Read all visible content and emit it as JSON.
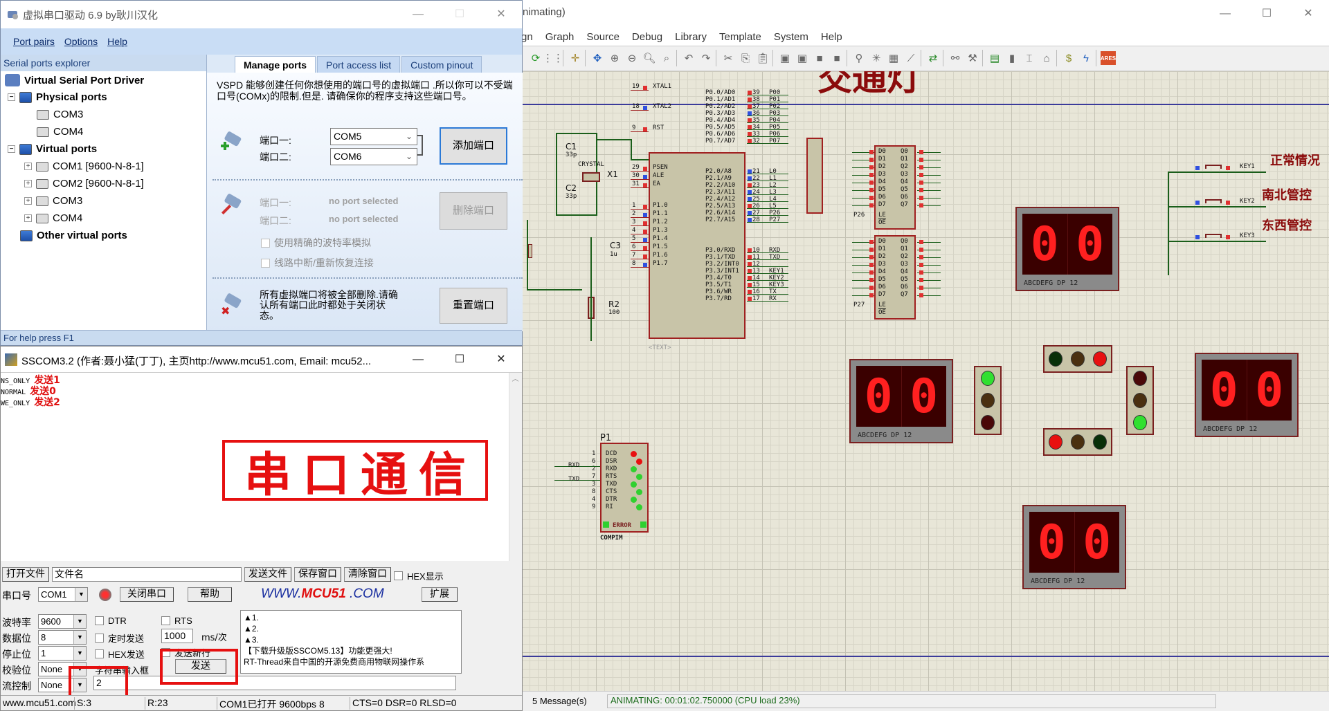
{
  "proteus": {
    "title": "nimating)",
    "window_controls": {
      "minimize": "—",
      "maximize": "☐",
      "close": "✕"
    },
    "menu": [
      "gn",
      "Graph",
      "Source",
      "Debug",
      "Library",
      "Template",
      "System",
      "Help"
    ],
    "toolbar_icons": [
      "refresh-icon",
      "grid-icon",
      "origin-icon",
      "pan-icon",
      "zoom-in-icon",
      "zoom-out-icon",
      "zoom-all-icon",
      "zoom-area-icon",
      "undo-icon",
      "redo-icon",
      "cut-icon",
      "copy-icon",
      "paste-icon",
      "block-copy-icon",
      "block-move-icon",
      "block-rotate-icon",
      "block-delete-icon",
      "pick-device-icon",
      "make-device-icon",
      "packaging-icon",
      "decompose-icon",
      "wire-autorouter-icon",
      "search-icon",
      "property-assign-icon",
      "new-sheet-icon",
      "remove-sheet-icon",
      "exit-sheet-icon",
      "goto-child-icon",
      "bill-of-materials-icon",
      "electrical-rule-check-icon",
      "ares-icon"
    ],
    "ares_label": "ARES",
    "schematic": {
      "title_fragment": "交通灯",
      "mcu": {
        "left_pins": [
          {
            "num": "19",
            "name": "XTAL1"
          },
          {
            "num": "18",
            "name": "XTAL2"
          },
          {
            "num": "9",
            "name": "RST"
          },
          {
            "num": "29",
            "name": "PSEN"
          },
          {
            "num": "30",
            "name": "ALE"
          },
          {
            "num": "31",
            "name": "EA"
          },
          {
            "num": "1",
            "name": "P1.0"
          },
          {
            "num": "2",
            "name": "P1.1"
          },
          {
            "num": "3",
            "name": "P1.2"
          },
          {
            "num": "4",
            "name": "P1.3"
          },
          {
            "num": "5",
            "name": "P1.4"
          },
          {
            "num": "6",
            "name": "P1.5"
          },
          {
            "num": "7",
            "name": "P1.6"
          },
          {
            "num": "8",
            "name": "P1.7"
          }
        ],
        "right_pins": [
          {
            "num": "39",
            "name": "P0.0/AD0",
            "net": "P00"
          },
          {
            "num": "38",
            "name": "P0.1/AD1",
            "net": "P01"
          },
          {
            "num": "37",
            "name": "P0.2/AD2",
            "net": "P02"
          },
          {
            "num": "36",
            "name": "P0.3/AD3",
            "net": "P03"
          },
          {
            "num": "35",
            "name": "P0.4/AD4",
            "net": "P04"
          },
          {
            "num": "34",
            "name": "P0.5/AD5",
            "net": "P05"
          },
          {
            "num": "33",
            "name": "P0.6/AD6",
            "net": "P06"
          },
          {
            "num": "32",
            "name": "P0.7/AD7",
            "net": "P07"
          },
          {
            "num": "21",
            "name": "P2.0/A8",
            "net": "L0"
          },
          {
            "num": "22",
            "name": "P2.1/A9",
            "net": "L1"
          },
          {
            "num": "23",
            "name": "P2.2/A10",
            "net": "L2"
          },
          {
            "num": "24",
            "name": "P2.3/A11",
            "net": "L3"
          },
          {
            "num": "25",
            "name": "P2.4/A12",
            "net": "L4"
          },
          {
            "num": "26",
            "name": "P2.5/A13",
            "net": "L5"
          },
          {
            "num": "27",
            "name": "P2.6/A14",
            "net": "P26"
          },
          {
            "num": "28",
            "name": "P2.7/A15",
            "net": "P27"
          },
          {
            "num": "10",
            "name": "P3.0/RXD",
            "net": "RXD"
          },
          {
            "num": "11",
            "name": "P3.1/TXD",
            "net": "TXD"
          },
          {
            "num": "12",
            "name": "P3.2/INT0",
            "net": ""
          },
          {
            "num": "13",
            "name": "P3.3/INT1",
            "net": "KEY1"
          },
          {
            "num": "14",
            "name": "P3.4/T0",
            "net": "KEY2"
          },
          {
            "num": "15",
            "name": "P3.5/T1",
            "net": "KEY3"
          },
          {
            "num": "16",
            "name": "P3.6/WR",
            "net": "TX"
          },
          {
            "num": "17",
            "name": "P3.7/RD",
            "net": "RX"
          }
        ],
        "text_tag": "<TEXT>"
      },
      "components": {
        "c1": {
          "ref": "C1",
          "value": "33p"
        },
        "c2": {
          "ref": "C2",
          "value": "33p"
        },
        "c3": {
          "ref": "C3",
          "value": "1u"
        },
        "r2": {
          "ref": "R2",
          "value": "100"
        },
        "x1": {
          "ref": "X1",
          "value": "CRYSTAL"
        },
        "p1": {
          "ref": "P1",
          "value": "COMPIM",
          "pins": [
            "DCD",
            "DSR",
            "RXD",
            "RTS",
            "TXD",
            "CTS",
            "DTR",
            "RI"
          ],
          "pin_nums": [
            "1",
            "6",
            "2",
            "7",
            "3",
            "8",
            "4",
            "9"
          ],
          "error_label": "ERROR",
          "nets": {
            "rxd": "RXD",
            "txd": "TXD"
          }
        }
      },
      "latch": {
        "inputs": [
          "D0",
          "D1",
          "D2",
          "D3",
          "D4",
          "D5",
          "D6",
          "D7"
        ],
        "outputs": [
          "Q0",
          "Q1",
          "Q2",
          "Q3",
          "Q4",
          "Q5",
          "Q6",
          "Q7"
        ],
        "le": "LE",
        "oe": "OE",
        "u1_le_net": "P26",
        "u2_le_net": "P27"
      },
      "keys": [
        {
          "net": "KEY1",
          "label": "正常情况"
        },
        {
          "net": "KEY2",
          "label": "南北管控"
        },
        {
          "net": "KEY3",
          "label": "东西管控"
        }
      ],
      "displays": [
        {
          "id": "north",
          "digits": [
            "0",
            "0"
          ],
          "caption": "ABCDEFG  DP     12"
        },
        {
          "id": "west",
          "digits": [
            "0",
            "0"
          ],
          "caption": "ABCDEFG  DP     12"
        },
        {
          "id": "east",
          "digits": [
            "0",
            "0"
          ],
          "caption": "ABCDEFG  DP     12"
        },
        {
          "id": "south",
          "digits": [
            "0",
            "0"
          ],
          "caption": "ABCDEFG  DP     12"
        }
      ],
      "traffic_lights": {
        "north": {
          "lamps": [
            "green-off",
            "yellow-off",
            "red-on"
          ],
          "pins": [
            "L0",
            "L1",
            "L2"
          ]
        },
        "south": {
          "lamps": [
            "red-on",
            "yellow-off",
            "green-off"
          ],
          "pins": [
            "L2",
            "L1",
            "L0"
          ]
        },
        "west": {
          "lamps": [
            "green-on",
            "yellow-off",
            "red-off"
          ],
          "pins": [
            "L5",
            "L4",
            "L3"
          ]
        },
        "east": {
          "lamps": [
            "red-off",
            "yellow-off",
            "green-on"
          ],
          "pins": [
            "L3",
            "L4",
            "L5"
          ]
        }
      },
      "lamp_colors": {
        "red_on": "#e81010",
        "red_off": "#4a0808",
        "yellow_off": "#4a3010",
        "green_on": "#30e030",
        "green_off": "#083008"
      }
    },
    "status": {
      "messages": "5 Message(s)",
      "animating": "ANIMATING: 00:01:02.750000 (CPU load 23%)"
    }
  },
  "vspd": {
    "title": "虚拟串口驱动 6.9 by耿川汉化",
    "menu": [
      "Port pairs",
      "Options",
      "Help"
    ],
    "explorer": {
      "header": "Serial ports explorer",
      "root": "Virtual Serial Port Driver",
      "physical": {
        "label": "Physical ports",
        "items": [
          "COM3",
          "COM4"
        ]
      },
      "virtual": {
        "label": "Virtual ports",
        "items": [
          "COM1 [9600-N-8-1]",
          "COM2 [9600-N-8-1]",
          "COM3",
          "COM4"
        ]
      },
      "other": "Other virtual ports"
    },
    "tabs": [
      "Manage ports",
      "Port access list",
      "Custom pinout"
    ],
    "description": "VSPD 能够创建任何你想使用的端口号的虚拟端口 .所以你可以不受端口号(COMx)的限制.但是. 请确保你的程序支持这些端口号。",
    "add": {
      "port1_label": "端口一:",
      "port2_label": "端口二:",
      "port1_value": "COM5",
      "port2_value": "COM6",
      "button": "添加端口"
    },
    "delete": {
      "port1_label": "端口一:",
      "port2_label": "端口二:",
      "port1_value": "no port selected",
      "port2_value": "no port selected",
      "button": "删除端口"
    },
    "options": {
      "baud_emulation": "使用精确的波特率模拟",
      "line_break": "线路中断/重新恢复连接"
    },
    "reset": {
      "text": "所有虚拟端口将被全部删除.请确认所有端口此时都处于关闭状态。",
      "button": "重置端口"
    },
    "status": "For help press F1"
  },
  "sscom": {
    "title": "SSCOM3.2 (作者:聂小猛(丁丁), 主页http://www.mcu51.com,  Email: mcu52...",
    "received_lines": [
      "NS_ONLY",
      "NORMAL",
      "WE_ONLY"
    ],
    "annotations": [
      "发送1",
      "发送0",
      "发送2"
    ],
    "banner": [
      "串",
      "口",
      "通",
      "信"
    ],
    "row1": {
      "open_file": "打开文件",
      "filename": "文件名",
      "send_file": "发送文件",
      "save_window": "保存窗口",
      "clear_window": "清除窗口",
      "hex_display": "HEX显示"
    },
    "row2": {
      "port_label": "串口号",
      "port_value": "COM1",
      "close_port": "关闭串口",
      "help": "帮助",
      "logo_prefix": "WWW.",
      "logo_brand": "MCU51",
      "logo_suffix": " .COM",
      "expand": "扩展"
    },
    "settings": {
      "baud_label": "波特率",
      "baud": "9600",
      "databits_label": "数据位",
      "databits": "8",
      "stopbits_label": "停止位",
      "stopbits": "1",
      "parity_label": "校验位",
      "parity": "None",
      "flow_label": "流控制",
      "flow": "None"
    },
    "options": {
      "dtr": "DTR",
      "rts": "RTS",
      "timed_send": "定时发送",
      "interval": "1000",
      "interval_unit": "ms/次",
      "hex_send": "HEX发送",
      "send_newline": "发送新行",
      "input_label": "字符串输入框",
      "send": "发送"
    },
    "input_value": "2",
    "ads": [
      "▲1.",
      "▲2.",
      "▲3.",
      "【下载升级版SSCOM5.13】功能更强大!",
      "RT-Thread来自中国的开源免费商用物联网操作系"
    ],
    "status": {
      "site": "www.mcu51.com",
      "sent": "S:3",
      "received": "R:23",
      "port_state": "COM1已打开  9600bps  8",
      "lines": "CTS=0 DSR=0 RLSD=0"
    }
  }
}
